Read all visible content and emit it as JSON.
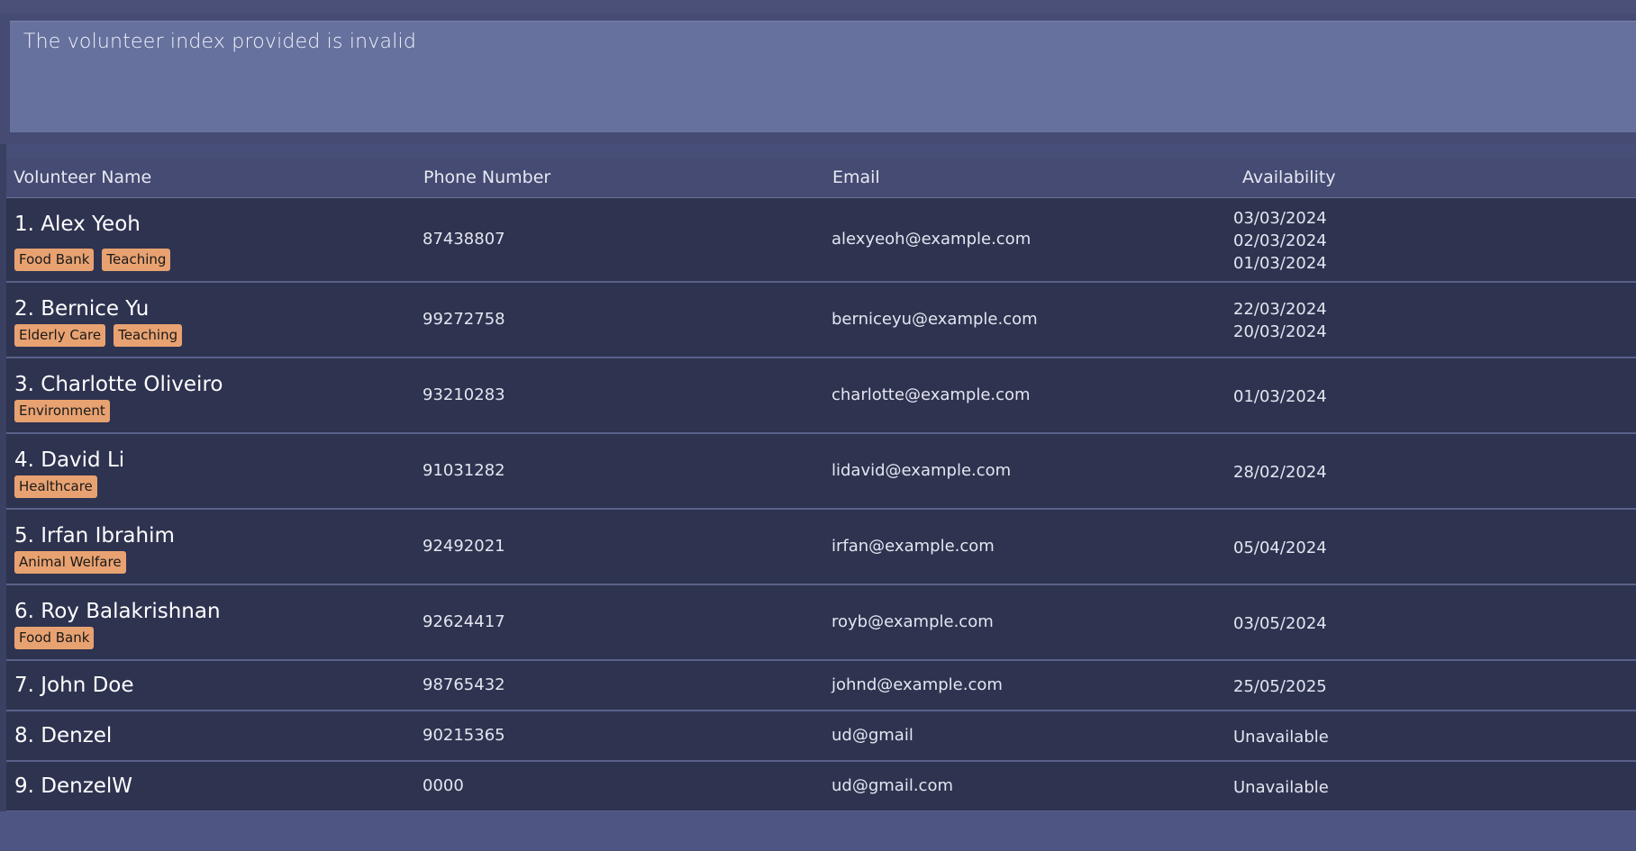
{
  "result": {
    "message": "The volunteer index provided is invalid"
  },
  "table": {
    "headers": {
      "name": "Volunteer Name",
      "phone": "Phone Number",
      "email": "Email",
      "availability": "Availability"
    },
    "rows": [
      {
        "name": "1. Alex Yeoh",
        "tags": [
          "Food Bank",
          "Teaching"
        ],
        "phone": "87438807",
        "email": "alexyeoh@example.com",
        "availability": [
          "03/03/2024",
          "02/03/2024",
          "01/03/2024"
        ]
      },
      {
        "name": "2. Bernice Yu",
        "tags": [
          "Elderly Care",
          "Teaching"
        ],
        "phone": "99272758",
        "email": "berniceyu@example.com",
        "availability": [
          "22/03/2024",
          "20/03/2024"
        ]
      },
      {
        "name": "3. Charlotte Oliveiro",
        "tags": [
          "Environment"
        ],
        "phone": "93210283",
        "email": "charlotte@example.com",
        "availability": [
          "01/03/2024"
        ]
      },
      {
        "name": "4. David Li",
        "tags": [
          "Healthcare"
        ],
        "phone": "91031282",
        "email": "lidavid@example.com",
        "availability": [
          "28/02/2024"
        ]
      },
      {
        "name": "5. Irfan Ibrahim",
        "tags": [
          "Animal Welfare"
        ],
        "phone": "92492021",
        "email": "irfan@example.com",
        "availability": [
          "05/04/2024"
        ]
      },
      {
        "name": "6. Roy Balakrishnan",
        "tags": [
          "Food Bank"
        ],
        "phone": "92624417",
        "email": "royb@example.com",
        "availability": [
          "03/05/2024"
        ]
      },
      {
        "name": "7. John Doe",
        "tags": [],
        "phone": "98765432",
        "email": "johnd@example.com",
        "availability": [
          "25/05/2025"
        ]
      },
      {
        "name": "8. Denzel",
        "tags": [],
        "phone": "90215365",
        "email": "ud@gmail",
        "availability": [
          "Unavailable"
        ]
      },
      {
        "name": "9. DenzelW",
        "tags": [],
        "phone": "0000",
        "email": "ud@gmail.com",
        "availability": [
          "Unavailable"
        ]
      }
    ]
  },
  "colors": {
    "tag_background": "#e8a271",
    "row_background": "#2e3350",
    "result_box": "#66719e"
  }
}
